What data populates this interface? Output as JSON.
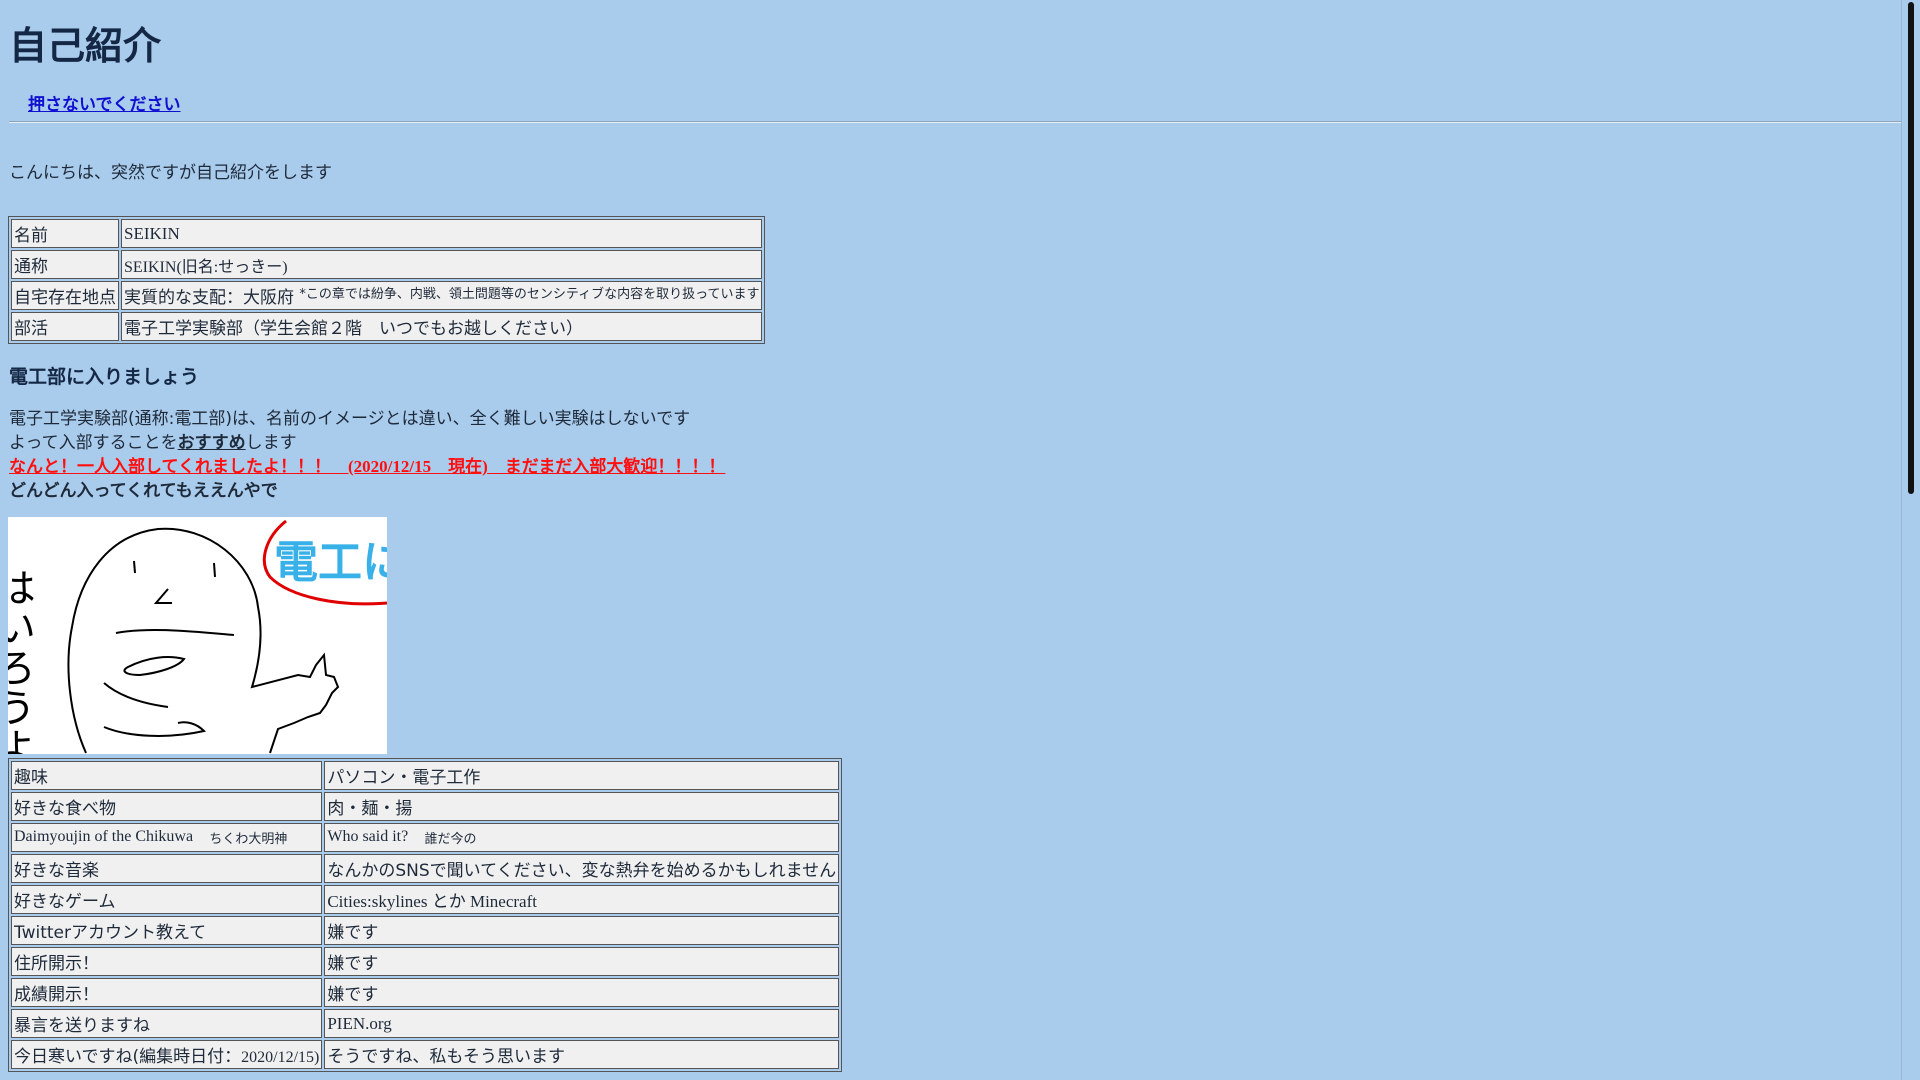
{
  "title": "自己紹介",
  "dont_push_link": "押さないでください",
  "intro": "こんにちは、突然ですが自己紹介をします",
  "profile_table": {
    "rows": [
      {
        "label": "名前",
        "value": "SEIKIN"
      },
      {
        "label": "通称",
        "value": "SEIKIN(旧名:せっきー)"
      },
      {
        "label": "自宅存在地点",
        "value": "実質的な支配：大阪府",
        "note": "*この章では紛争、内戦、領土問題等のセンシティブな内容を取り扱っています"
      },
      {
        "label": "部活",
        "value": "電子工学実験部（学生会館２階　いつでもお越しください）"
      }
    ]
  },
  "section_heading": "電工部に入りましょう",
  "paragraphs": {
    "line1": "電子工学実験部(通称:電工部)は、名前のイメージとは違い、全く難しい実験はしないです",
    "line2_before": "よって入部することを",
    "line2_emph": "おすすめ",
    "line2_after": "します",
    "line3_a": "なんと！一人入部してくれましたよ！！！　",
    "line3_date": "(2020/12/15　現在)",
    "line3_b": "　まだまだ入部大歓迎！！！！",
    "line4": "どんどん入ってくれてもええんやで"
  },
  "drawing": {
    "left_text": "はいろうよ",
    "bubble_text": "電工に"
  },
  "hobby_table": {
    "rows": [
      {
        "label": "趣味",
        "value": "パソコン・電子工作"
      },
      {
        "label": "好きな食べ物",
        "value": "肉・麺・揚"
      },
      {
        "label": "Daimyoujin of the Chikuwa",
        "label_small": "ちくわ大明神",
        "value": "Who said it?",
        "value_small": "誰だ今の"
      },
      {
        "label": "好きな音楽",
        "value": "なんかのSNSで聞いてください、変な熱弁を始めるかもしれません"
      },
      {
        "label": "好きなゲーム",
        "value": "Cities:skylines とか Minecraft"
      },
      {
        "label": "Twitterアカウント教えて",
        "value": "嫌です"
      },
      {
        "label": "住所開示！",
        "value": "嫌です"
      },
      {
        "label": "成績開示！",
        "value": "嫌です"
      },
      {
        "label": "暴言を送りますね",
        "value": "PIEN.org"
      },
      {
        "label": "今日寒いですね(編集時日付：",
        "label_date": "2020/12/15)",
        "value": "そうですね、私もそう思います"
      }
    ]
  },
  "colors": {
    "background": "#a9cbec",
    "link": "#1010d0",
    "alert": "#ff1010",
    "cell": "#f0f0f0"
  }
}
